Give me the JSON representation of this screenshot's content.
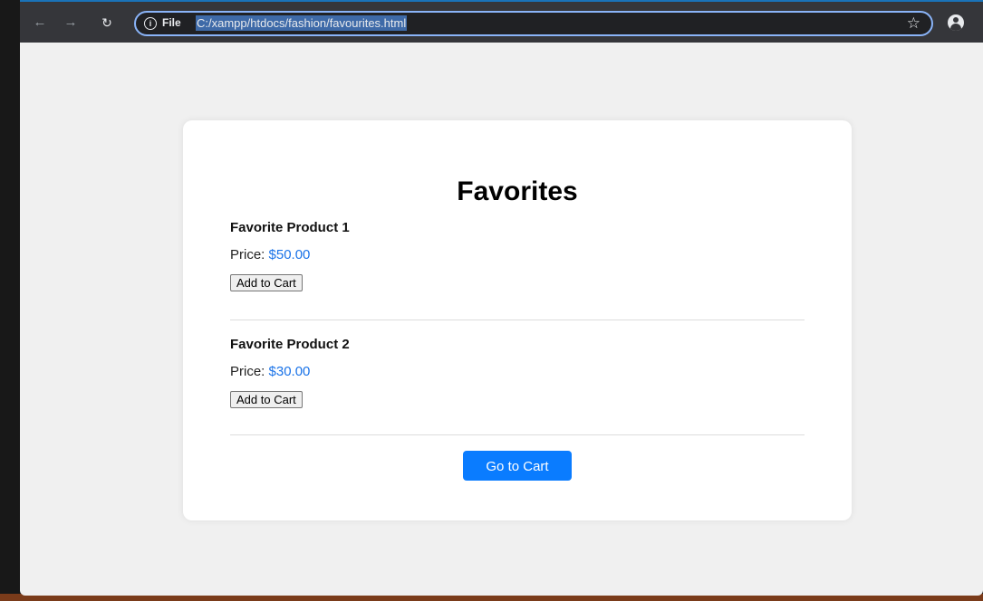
{
  "browser": {
    "address_bar": {
      "scheme_label": "File",
      "url": "C:/xampp/htdocs/fashion/favourites.html"
    },
    "icons": {
      "back": "back-arrow-icon",
      "forward": "forward-arrow-icon",
      "reload": "reload-icon",
      "info": "info-icon",
      "bookmark": "star-icon",
      "profile": "profile-icon"
    },
    "accent_color": "#8ab4f8"
  },
  "page": {
    "title": "Favorites",
    "products": [
      {
        "name": "Favorite Product 1",
        "price_label": "Price: ",
        "price": "$50.00",
        "button_label": "Add to Cart"
      },
      {
        "name": "Favorite Product 2",
        "price_label": "Price: ",
        "price": "$30.00",
        "button_label": "Add to Cart"
      }
    ],
    "cart_button_label": "Go to Cart",
    "colors": {
      "price": "#1a73e8",
      "primary_button": "#0a7cff",
      "card_background": "#ffffff",
      "page_background": "#f0f0f0"
    }
  }
}
